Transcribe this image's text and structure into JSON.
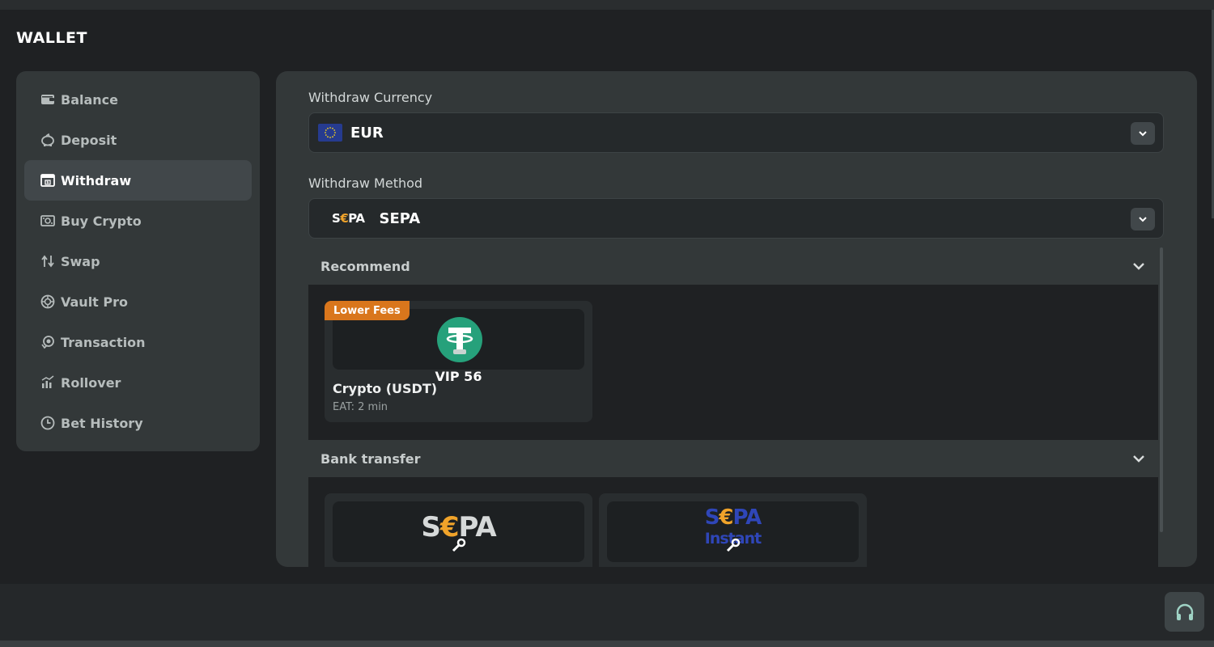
{
  "page": {
    "title": "WALLET"
  },
  "sidebar": {
    "items": [
      {
        "label": "Balance",
        "icon": "wallet-icon",
        "active": false
      },
      {
        "label": "Deposit",
        "icon": "piggy-bank-icon",
        "active": false
      },
      {
        "label": "Withdraw",
        "icon": "cash-register-icon",
        "active": true
      },
      {
        "label": "Buy Crypto",
        "icon": "money-bill-icon",
        "active": false
      },
      {
        "label": "Swap",
        "icon": "swap-arrows-icon",
        "active": false
      },
      {
        "label": "Vault Pro",
        "icon": "vault-icon",
        "active": false
      },
      {
        "label": "Transaction",
        "icon": "coin-transfer-icon",
        "active": false
      },
      {
        "label": "Rollover",
        "icon": "bar-chart-icon",
        "active": false
      },
      {
        "label": "Bet History",
        "icon": "clock-icon",
        "active": false
      }
    ]
  },
  "withdraw": {
    "currency_label": "Withdraw Currency",
    "currency_value": "EUR",
    "method_label": "Withdraw Method",
    "method_logo": {
      "s": "S",
      "euro": "€",
      "rest": "PA"
    },
    "method_value": "SEPA"
  },
  "sections": {
    "recommend": {
      "title": "Recommend",
      "card": {
        "badge": "Lower Fees",
        "vip": "VIP 56",
        "title": "Crypto (USDT)",
        "subtitle": "EAT: 2 min"
      }
    },
    "bank": {
      "title": "Bank transfer",
      "sepa_logo": {
        "s": "S",
        "euro": "€",
        "rest": "PA"
      },
      "sepa_instant_logo": {
        "s": "S",
        "euro": "€",
        "rest": "PA",
        "word": "Instant"
      }
    }
  },
  "colors": {
    "background": "#1f2123",
    "panel": "#333839",
    "accent_badge": "#d9761c",
    "usdt_green": "#26a17b",
    "sepa_gold": "#f0a32a",
    "sepa_instant_blue": "#2f46b8"
  }
}
